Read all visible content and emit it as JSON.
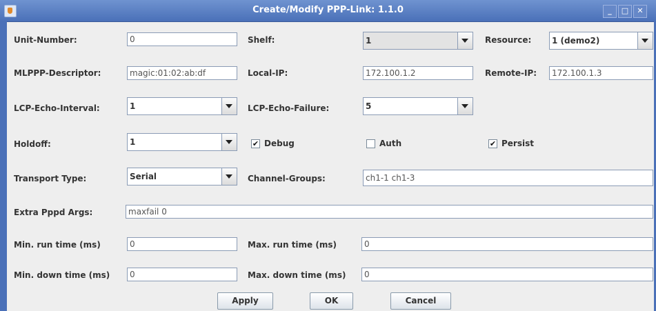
{
  "window": {
    "title": "Create/Modify PPP-Link: 1.1.0"
  },
  "labels": {
    "unit_number": "Unit-Number:",
    "shelf": "Shelf:",
    "resource": "Resource:",
    "mlppp": "MLPPP-Descriptor:",
    "local_ip": "Local-IP:",
    "remote_ip": "Remote-IP:",
    "lcp_interval": "LCP-Echo-Interval:",
    "lcp_failure": "LCP-Echo-Failure:",
    "holdoff": "Holdoff:",
    "transport": "Transport Type:",
    "channel_groups": "Channel-Groups:",
    "extra_args": "Extra Pppd Args:",
    "min_run": "Min. run time (ms)",
    "max_run": "Max. run time (ms)",
    "min_down": "Min. down time (ms)",
    "max_down": "Max. down time (ms)"
  },
  "values": {
    "unit_number": "0",
    "shelf": "1",
    "resource": "1 (demo2)",
    "mlppp": "magic:01:02:ab:df",
    "local_ip": "172.100.1.2",
    "remote_ip": "172.100.1.3",
    "lcp_interval": "1",
    "lcp_failure": "5",
    "holdoff": "1",
    "transport": "Serial",
    "channel_groups": "ch1-1 ch1-3",
    "extra_args": "maxfail 0",
    "min_run": "0",
    "max_run": "0",
    "min_down": "0",
    "max_down": "0"
  },
  "checkboxes": {
    "debug": {
      "label": "Debug",
      "checked": true,
      "mark": "✔"
    },
    "auth": {
      "label": "Auth",
      "checked": false,
      "mark": ""
    },
    "persist": {
      "label": "Persist",
      "checked": true,
      "mark": "✔"
    }
  },
  "buttons": {
    "apply": "Apply",
    "ok": "OK",
    "cancel": "Cancel"
  },
  "titlebar_buttons": {
    "minimize": "_",
    "maximize": "□",
    "close": "✕"
  }
}
